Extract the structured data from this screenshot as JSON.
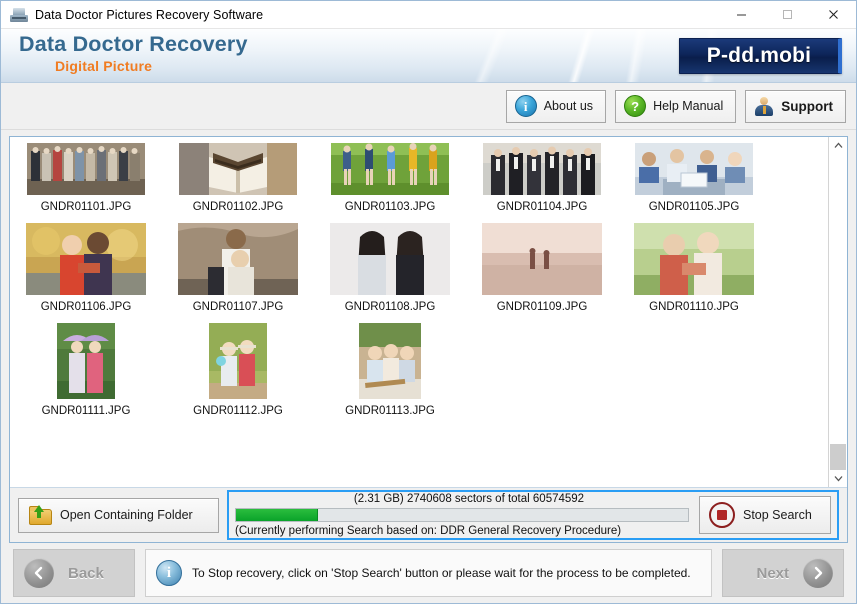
{
  "window": {
    "title": "Data Doctor Pictures Recovery Software",
    "minimize_label": "—",
    "maximize_label": "□",
    "close_label": "✕"
  },
  "banner": {
    "title": "Data Doctor Recovery",
    "subtitle": "Digital Picture",
    "logo": "P-dd.mobi",
    "title_color": "#35698f",
    "subtitle_color": "#f07c22",
    "logo_bg": "#0d2559"
  },
  "toolbar": {
    "about_label": "About us",
    "about_icon": "info-icon",
    "help_label": "Help Manual",
    "help_icon": "question-icon",
    "support_label": "Support",
    "support_icon": "person-icon"
  },
  "file_grid": {
    "rows": [
      [
        {
          "name": "GNDR01101.JPG",
          "shape": "land"
        },
        {
          "name": "GNDR01102.JPG",
          "shape": "land"
        },
        {
          "name": "GNDR01103.JPG",
          "shape": "land"
        },
        {
          "name": "GNDR01104.JPG",
          "shape": "land"
        },
        {
          "name": "GNDR01105.JPG",
          "shape": "land"
        }
      ],
      [
        {
          "name": "GNDR01106.JPG",
          "shape": "sq"
        },
        {
          "name": "GNDR01107.JPG",
          "shape": "sq"
        },
        {
          "name": "GNDR01108.JPG",
          "shape": "sq"
        },
        {
          "name": "GNDR01109.JPG",
          "shape": "sq"
        },
        {
          "name": "GNDR01110.JPG",
          "shape": "sq"
        }
      ],
      [
        {
          "name": "GNDR01111.JPG",
          "shape": "port"
        },
        {
          "name": "GNDR01112.JPG",
          "shape": "port"
        },
        {
          "name": "GNDR01113.JPG",
          "shape": "port2"
        }
      ]
    ],
    "scroll_up_icon": "chevron-up-icon",
    "scroll_down_icon": "chevron-down-icon"
  },
  "actions": {
    "open_folder_label": "Open Containing Folder",
    "open_folder_icon": "folder-up-icon",
    "stop_label": "Stop Search",
    "stop_icon": "stop-icon"
  },
  "progress": {
    "count_text": "(2.31 GB) 2740608   sectors  of  total 60574592",
    "note_text": "(Currently performing Search based on:  DDR General Recovery Procedure)",
    "percent": 18,
    "fill_color": "#0aa32a",
    "border_color": "#2a9df4",
    "size_label": "2.31 GB",
    "sectors_done": "2740608",
    "sectors_total": "60574592"
  },
  "footer": {
    "back_label": "Back",
    "back_icon": "chevron-left-icon",
    "next_label": "Next",
    "next_icon": "chevron-right-icon",
    "info_icon": "info-icon",
    "info_text": "To Stop recovery, click on 'Stop Search' button or please wait for the process to be completed."
  }
}
